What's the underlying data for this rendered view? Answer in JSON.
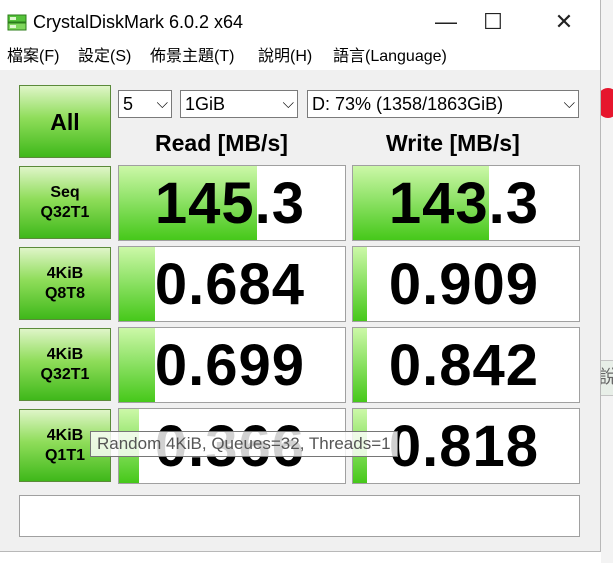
{
  "window": {
    "title": "CrystalDiskMark 6.0.2 x64",
    "minimize_glyph": "—",
    "maximize_glyph": "☐",
    "close_glyph": "✕"
  },
  "menu": [
    "檔案(F)",
    "設定(S)",
    "佈景主題(T)",
    "說明(H)",
    "語言(Language)"
  ],
  "controls": {
    "all_label": "All",
    "count": "5",
    "size": "1GiB",
    "drive": "D: 73% (1358/1863GiB)"
  },
  "headers": {
    "read": "Read [MB/s]",
    "write": "Write [MB/s]"
  },
  "tests": [
    {
      "line1": "Seq",
      "line2": "Q32T1",
      "read": "145.3",
      "write": "143.3",
      "read_fill": 0.61,
      "write_fill": 0.6
    },
    {
      "line1": "4KiB",
      "line2": "Q8T8",
      "read": "0.684",
      "write": "0.909",
      "read_fill": 0.16,
      "write_fill": 0.06
    },
    {
      "line1": "4KiB",
      "line2": "Q32T1",
      "read": "0.699",
      "write": "0.842",
      "read_fill": 0.16,
      "write_fill": 0.06
    },
    {
      "line1": "4KiB",
      "line2": "Q1T1",
      "read": "0.366",
      "write": "0.818",
      "read_fill": 0.09,
      "write_fill": 0.06
    }
  ],
  "tooltip": "Random 4KiB, Queues=32, Threads=1",
  "comment": "",
  "background_fragment": "說",
  "colors": {
    "bar_top": "#ccf8a8",
    "bar_bottom": "#46c81a",
    "button_green": "#3fb81a"
  }
}
